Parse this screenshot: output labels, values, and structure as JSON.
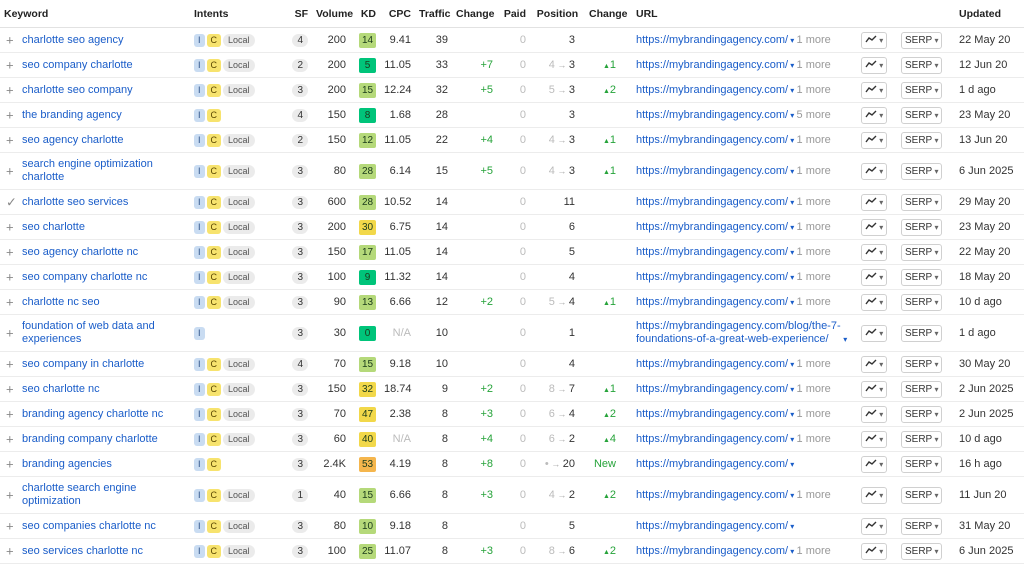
{
  "columns": [
    "Keyword",
    "Intents",
    "SF",
    "Volume",
    "KD",
    "CPC",
    "Traffic",
    "Change",
    "Paid",
    "Position",
    "Change",
    "URL",
    "",
    "",
    "Updated"
  ],
  "controls": {
    "trend_icon": "trend-icon",
    "serp_label": "SERP",
    "caret": "▾",
    "arrow": "→",
    "up": "▲"
  },
  "kd_colors": {
    "green": "#00c47a",
    "light_green": "#b5d97a",
    "yellow": "#f2d84a",
    "orange": "#f5b64d"
  },
  "rows": [
    {
      "mark": "+",
      "keyword": "charlotte seo agency",
      "intents": [
        "I",
        "C",
        "Local"
      ],
      "sf": "4",
      "volume": "200",
      "kd": "14",
      "kd_color": "#b5d97a",
      "cpc": "9.41",
      "traffic": "39",
      "tchange": "",
      "paid": "0",
      "pos_from": "",
      "pos_to": "3",
      "pchange": "",
      "url": "https://mybrandingagency.com/",
      "more": "1 more",
      "updated": "22 May 20"
    },
    {
      "mark": "+",
      "keyword": "seo company charlotte",
      "intents": [
        "I",
        "C",
        "Local"
      ],
      "sf": "2",
      "volume": "200",
      "kd": "5",
      "kd_color": "#00c47a",
      "cpc": "11.05",
      "traffic": "33",
      "tchange": "+7",
      "paid": "0",
      "pos_from": "4",
      "pos_to": "3",
      "pchange": "1",
      "url": "https://mybrandingagency.com/",
      "more": "1 more",
      "updated": "12 Jun 20"
    },
    {
      "mark": "+",
      "keyword": "charlotte seo company",
      "intents": [
        "I",
        "C",
        "Local"
      ],
      "sf": "3",
      "volume": "200",
      "kd": "15",
      "kd_color": "#b5d97a",
      "cpc": "12.24",
      "traffic": "32",
      "tchange": "+5",
      "paid": "0",
      "pos_from": "5",
      "pos_to": "3",
      "pchange": "2",
      "url": "https://mybrandingagency.com/",
      "more": "1 more",
      "updated": "1 d ago"
    },
    {
      "mark": "+",
      "keyword": "the branding agency",
      "intents": [
        "I",
        "C"
      ],
      "sf": "4",
      "volume": "150",
      "kd": "8",
      "kd_color": "#00c47a",
      "cpc": "1.68",
      "traffic": "28",
      "tchange": "",
      "paid": "0",
      "pos_from": "",
      "pos_to": "3",
      "pchange": "",
      "url": "https://mybrandingagency.com/",
      "more": "5 more",
      "updated": "23 May 20"
    },
    {
      "mark": "+",
      "keyword": "seo agency charlotte",
      "intents": [
        "I",
        "C",
        "Local"
      ],
      "sf": "2",
      "volume": "150",
      "kd": "12",
      "kd_color": "#b5d97a",
      "cpc": "11.05",
      "traffic": "22",
      "tchange": "+4",
      "paid": "0",
      "pos_from": "4",
      "pos_to": "3",
      "pchange": "1",
      "url": "https://mybrandingagency.com/",
      "more": "1 more",
      "updated": "13 Jun 20"
    },
    {
      "mark": "+",
      "keyword": "search engine optimization charlotte",
      "intents": [
        "I",
        "C",
        "Local"
      ],
      "sf": "3",
      "volume": "80",
      "kd": "28",
      "kd_color": "#b5d97a",
      "cpc": "6.14",
      "traffic": "15",
      "tchange": "+5",
      "paid": "0",
      "pos_from": "4",
      "pos_to": "3",
      "pchange": "1",
      "url": "https://mybrandingagency.com/",
      "more": "1 more",
      "updated": "6 Jun 2025"
    },
    {
      "mark": "✓",
      "keyword": "charlotte seo services",
      "intents": [
        "I",
        "C",
        "Local"
      ],
      "sf": "3",
      "volume": "600",
      "kd": "28",
      "kd_color": "#b5d97a",
      "cpc": "10.52",
      "traffic": "14",
      "tchange": "",
      "paid": "0",
      "pos_from": "",
      "pos_to": "11",
      "pchange": "",
      "url": "https://mybrandingagency.com/",
      "more": "1 more",
      "updated": "29 May 20"
    },
    {
      "mark": "+",
      "keyword": "seo charlotte",
      "intents": [
        "I",
        "C",
        "Local"
      ],
      "sf": "3",
      "volume": "200",
      "kd": "30",
      "kd_color": "#f2d84a",
      "cpc": "6.75",
      "traffic": "14",
      "tchange": "",
      "paid": "0",
      "pos_from": "",
      "pos_to": "6",
      "pchange": "",
      "url": "https://mybrandingagency.com/",
      "more": "1 more",
      "updated": "23 May 20"
    },
    {
      "mark": "+",
      "keyword": "seo agency charlotte nc",
      "intents": [
        "I",
        "C",
        "Local"
      ],
      "sf": "3",
      "volume": "150",
      "kd": "17",
      "kd_color": "#b5d97a",
      "cpc": "11.05",
      "traffic": "14",
      "tchange": "",
      "paid": "0",
      "pos_from": "",
      "pos_to": "5",
      "pchange": "",
      "url": "https://mybrandingagency.com/",
      "more": "1 more",
      "updated": "22 May 20"
    },
    {
      "mark": "+",
      "keyword": "seo company charlotte nc",
      "intents": [
        "I",
        "C",
        "Local"
      ],
      "sf": "3",
      "volume": "100",
      "kd": "9",
      "kd_color": "#00c47a",
      "cpc": "11.32",
      "traffic": "14",
      "tchange": "",
      "paid": "0",
      "pos_from": "",
      "pos_to": "4",
      "pchange": "",
      "url": "https://mybrandingagency.com/",
      "more": "1 more",
      "updated": "18 May 20"
    },
    {
      "mark": "+",
      "keyword": "charlotte nc seo",
      "intents": [
        "I",
        "C",
        "Local"
      ],
      "sf": "3",
      "volume": "90",
      "kd": "13",
      "kd_color": "#b5d97a",
      "cpc": "6.66",
      "traffic": "12",
      "tchange": "+2",
      "paid": "0",
      "pos_from": "5",
      "pos_to": "4",
      "pchange": "1",
      "url": "https://mybrandingagency.com/",
      "more": "1 more",
      "updated": "10 d ago"
    },
    {
      "mark": "+",
      "keyword": "foundation of web data and experiences",
      "intents": [
        "I"
      ],
      "sf": "3",
      "volume": "30",
      "kd": "0",
      "kd_color": "#00c47a",
      "cpc": "N/A",
      "traffic": "10",
      "tchange": "",
      "paid": "0",
      "pos_from": "",
      "pos_to": "1",
      "pchange": "",
      "url": "https://mybrandingagency.com/blog/the-7-foundations-of-a-great-web-experience/",
      "more": "",
      "updated": "1 d ago"
    },
    {
      "mark": "+",
      "keyword": "seo company in charlotte",
      "intents": [
        "I",
        "C",
        "Local"
      ],
      "sf": "4",
      "volume": "70",
      "kd": "15",
      "kd_color": "#b5d97a",
      "cpc": "9.18",
      "traffic": "10",
      "tchange": "",
      "paid": "0",
      "pos_from": "",
      "pos_to": "4",
      "pchange": "",
      "url": "https://mybrandingagency.com/",
      "more": "1 more",
      "updated": "30 May 20"
    },
    {
      "mark": "+",
      "keyword": "seo charlotte nc",
      "intents": [
        "I",
        "C",
        "Local"
      ],
      "sf": "3",
      "volume": "150",
      "kd": "32",
      "kd_color": "#f2d84a",
      "cpc": "18.74",
      "traffic": "9",
      "tchange": "+2",
      "paid": "0",
      "pos_from": "8",
      "pos_to": "7",
      "pchange": "1",
      "url": "https://mybrandingagency.com/",
      "more": "1 more",
      "updated": "2 Jun 2025"
    },
    {
      "mark": "+",
      "keyword": "branding agency charlotte nc",
      "intents": [
        "I",
        "C",
        "Local"
      ],
      "sf": "3",
      "volume": "70",
      "kd": "47",
      "kd_color": "#f2d84a",
      "cpc": "2.38",
      "traffic": "8",
      "tchange": "+3",
      "paid": "0",
      "pos_from": "6",
      "pos_to": "4",
      "pchange": "2",
      "url": "https://mybrandingagency.com/",
      "more": "1 more",
      "updated": "2 Jun 2025"
    },
    {
      "mark": "+",
      "keyword": "branding company charlotte",
      "intents": [
        "I",
        "C",
        "Local"
      ],
      "sf": "3",
      "volume": "60",
      "kd": "40",
      "kd_color": "#f2d84a",
      "cpc": "N/A",
      "traffic": "8",
      "tchange": "+4",
      "paid": "0",
      "pos_from": "6",
      "pos_to": "2",
      "pchange": "4",
      "url": "https://mybrandingagency.com/",
      "more": "1 more",
      "updated": "10 d ago"
    },
    {
      "mark": "+",
      "keyword": "branding agencies",
      "intents": [
        "I",
        "C"
      ],
      "sf": "3",
      "volume": "2.4K",
      "kd": "53",
      "kd_color": "#f5b64d",
      "cpc": "4.19",
      "traffic": "8",
      "tchange": "+8",
      "paid": "0",
      "pos_from": "•",
      "pos_to": "20",
      "pchange": "New",
      "url": "https://mybrandingagency.com/",
      "more": "",
      "updated": "16 h ago"
    },
    {
      "mark": "+",
      "keyword": "charlotte search engine optimization",
      "intents": [
        "I",
        "C",
        "Local"
      ],
      "sf": "1",
      "volume": "40",
      "kd": "15",
      "kd_color": "#b5d97a",
      "cpc": "6.66",
      "traffic": "8",
      "tchange": "+3",
      "paid": "0",
      "pos_from": "4",
      "pos_to": "2",
      "pchange": "2",
      "url": "https://mybrandingagency.com/",
      "more": "1 more",
      "updated": "11 Jun 20"
    },
    {
      "mark": "+",
      "keyword": "seo companies charlotte nc",
      "intents": [
        "I",
        "C",
        "Local"
      ],
      "sf": "3",
      "volume": "80",
      "kd": "10",
      "kd_color": "#b5d97a",
      "cpc": "9.18",
      "traffic": "8",
      "tchange": "",
      "paid": "0",
      "pos_from": "",
      "pos_to": "5",
      "pchange": "",
      "url": "https://mybrandingagency.com/",
      "more": "",
      "updated": "31 May 20"
    },
    {
      "mark": "+",
      "keyword": "seo services charlotte nc",
      "intents": [
        "I",
        "C",
        "Local"
      ],
      "sf": "3",
      "volume": "100",
      "kd": "25",
      "kd_color": "#b5d97a",
      "cpc": "11.07",
      "traffic": "8",
      "tchange": "+3",
      "paid": "0",
      "pos_from": "8",
      "pos_to": "6",
      "pchange": "2",
      "url": "https://mybrandingagency.com/",
      "more": "1 more",
      "updated": "6 Jun 2025"
    }
  ]
}
